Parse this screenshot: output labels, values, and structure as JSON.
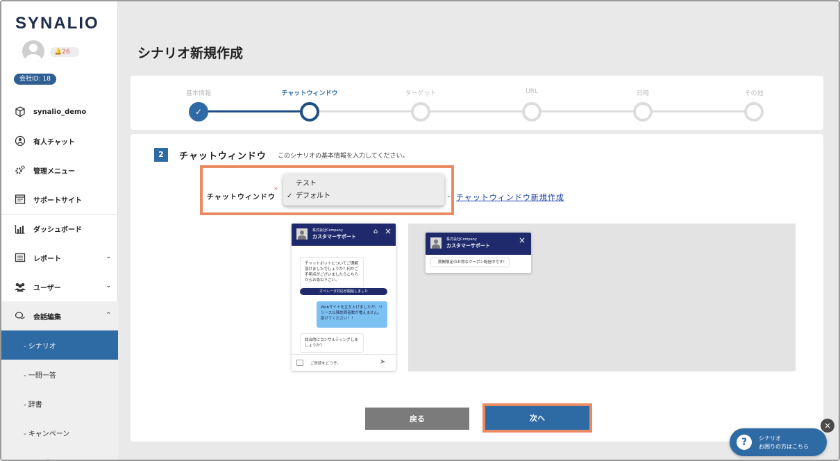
{
  "app": {
    "logo": "SYNALIO",
    "notifications": "26",
    "company_id": "会社ID: 18"
  },
  "sidebar": {
    "items": [
      {
        "label": "synalio_demo",
        "icon": "cube-icon"
      },
      {
        "label": "有人チャット",
        "icon": "headset-icon"
      },
      {
        "label": "管理メニュー",
        "icon": "gears-icon"
      },
      {
        "label": "サポートサイト",
        "icon": "browser-icon"
      },
      {
        "label": "ダッシュボード",
        "icon": "bar-chart-icon"
      },
      {
        "label": "レポート",
        "icon": "report-icon"
      },
      {
        "label": "ユーザー",
        "icon": "users-icon"
      },
      {
        "label": "会話編集",
        "icon": "chat-bubbles-icon"
      }
    ],
    "subitems": [
      {
        "label": "- シナリオ"
      },
      {
        "label": "- 一問一答"
      },
      {
        "label": "- 辞書"
      },
      {
        "label": "- キャンペーン"
      },
      {
        "label": "- テンプレート"
      }
    ]
  },
  "page": {
    "title": "シナリオ新規作成"
  },
  "stepper": {
    "steps": [
      {
        "label": "基本情報",
        "state": "done"
      },
      {
        "label": "チャットウィンドウ",
        "state": "current"
      },
      {
        "label": "ターゲット",
        "state": "todo"
      },
      {
        "label": "URL",
        "state": "todo"
      },
      {
        "label": "日時",
        "state": "todo"
      },
      {
        "label": "その他",
        "state": "todo"
      }
    ]
  },
  "section": {
    "number": "2",
    "title": "チャットウィンドウ",
    "description": "このシナリオの基本情報を入力してください。",
    "field_label": "チャットウィンドウ",
    "required_mark": "*",
    "dropdown_options": [
      "テスト",
      "デフォルト"
    ],
    "selected_option": "デフォルト",
    "new_link": "チャットウィンドウ新規作成"
  },
  "chat_preview": {
    "company": "株式会社Company",
    "name": "カスタマーサポート",
    "bot_message": "チャットボットについてご理解頂けましたでしょうか？何かご不明点がございましたらこちらからお尋ね下さい。",
    "operator_notice": "オペレータ対応が開始しました",
    "user_message": "Webサイトを立ち上げましたが、リリース以降訪問者数が増えません。助けてください！！",
    "bot_reply": "総合的にコンサルティングしましょうか？",
    "input_placeholder": "ご質問をどうぞ。"
  },
  "mini_preview": {
    "company": "株式会社Company",
    "name": "カスタマーサポート",
    "bubble": "期間限定のお得なクーポン配信中です！"
  },
  "buttons": {
    "back": "戻る",
    "next": "次へ"
  },
  "help": {
    "line1": "シナリオ",
    "line2": "お困りの方はこちら"
  },
  "colors": {
    "primary": "#2e6aa3",
    "chat_header": "#1e2a6b",
    "highlight": "#ea8a63"
  }
}
